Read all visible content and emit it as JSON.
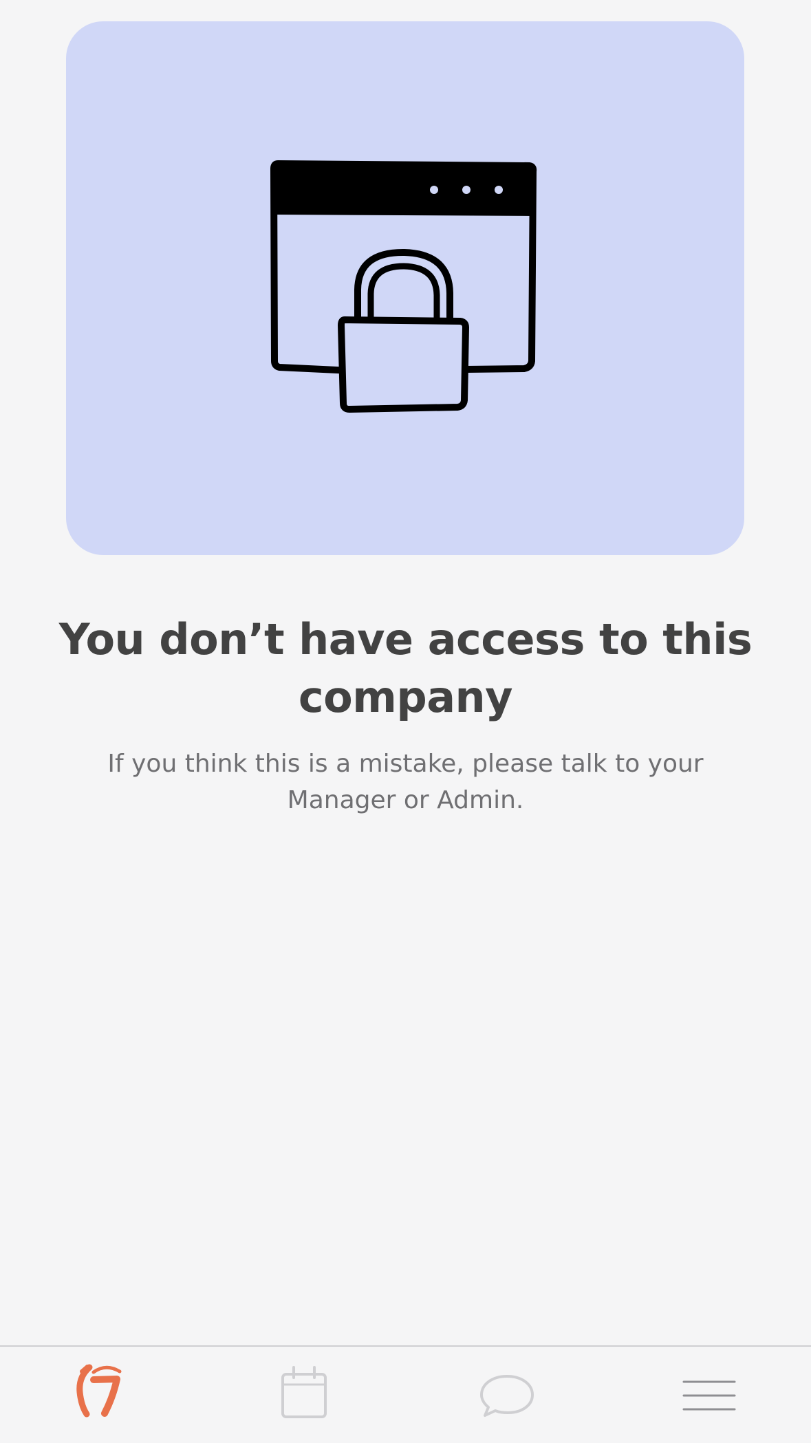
{
  "empty_state": {
    "title": "You don’t have access to this company",
    "message": "If you think this is a mistake, please talk to your Manager or Admin.",
    "illustration": "locked-browser-window-icon"
  },
  "tab_bar": {
    "items": [
      {
        "name": "home",
        "icon": "7shifts-logo-icon",
        "active": true
      },
      {
        "name": "schedule",
        "icon": "calendar-icon",
        "active": false
      },
      {
        "name": "messages",
        "icon": "chat-bubble-icon",
        "active": false
      },
      {
        "name": "menu",
        "icon": "hamburger-menu-icon",
        "active": false
      }
    ]
  },
  "colors": {
    "background": "#f5f5f6",
    "hero_card": "#d0d7f7",
    "title": "#424242",
    "message": "#6f6f72",
    "brand_orange": "#e8714a",
    "inactive_icon": "#cfcfd2"
  }
}
